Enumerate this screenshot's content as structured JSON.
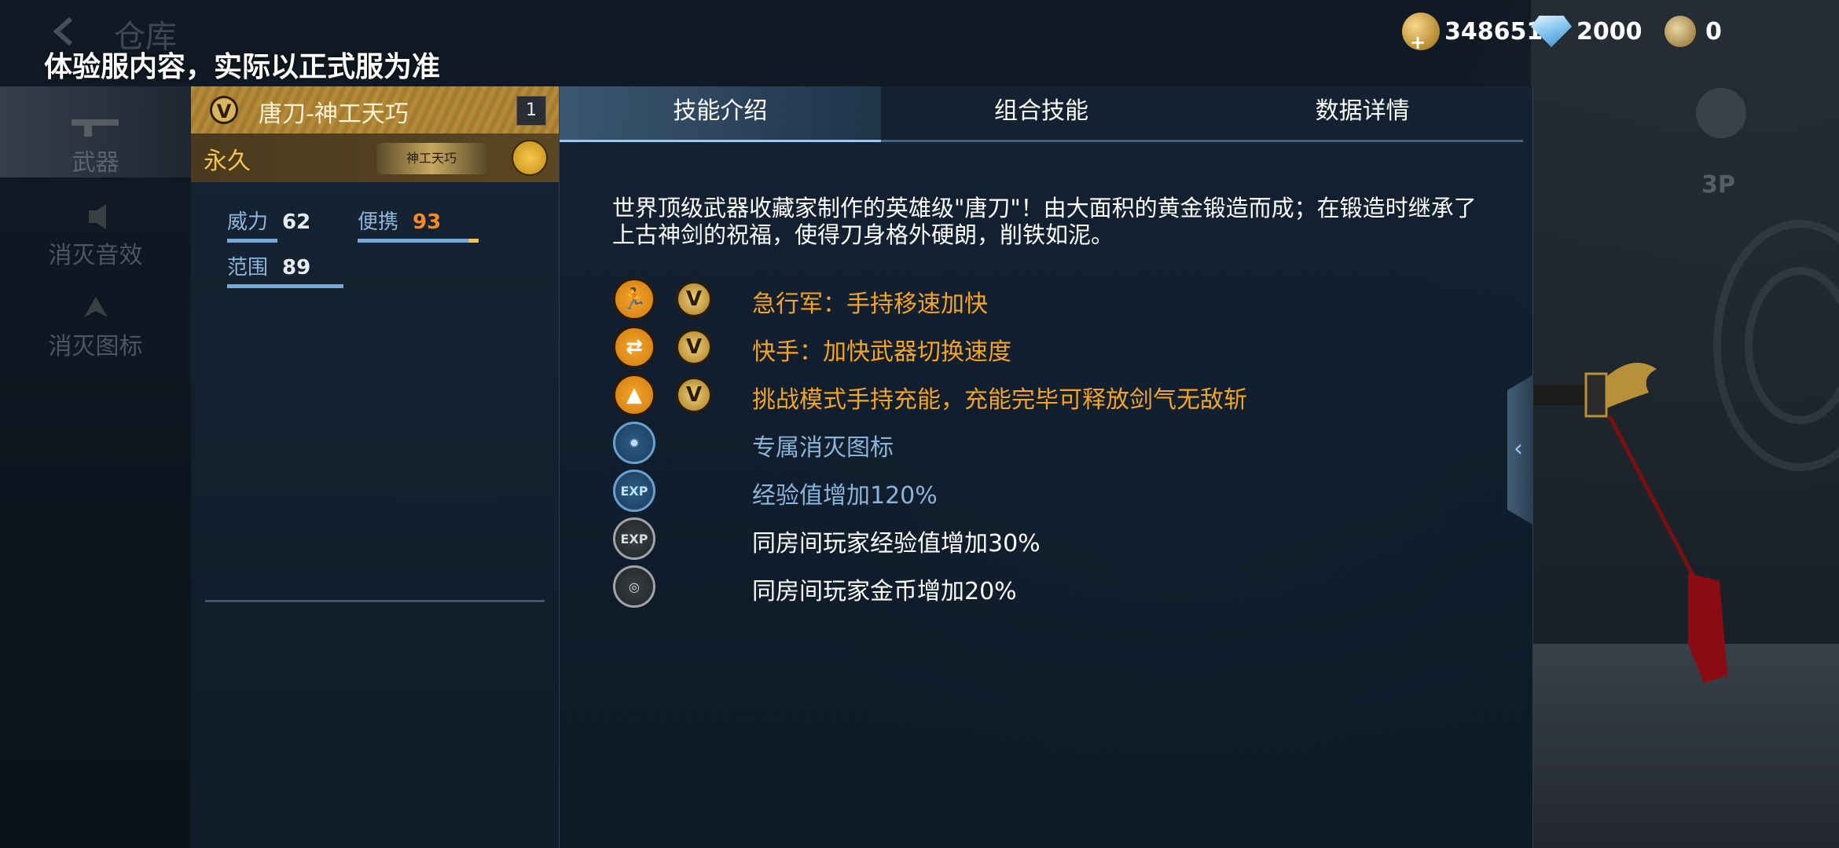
{
  "header": {
    "back_title": "仓库",
    "notice": "体验服内容，实际以正式服为准"
  },
  "currency": {
    "gold": "348651",
    "diamond": "2000",
    "medal": "0"
  },
  "side_nav": {
    "items": [
      {
        "label": "武器",
        "icon": "rifle-icon",
        "active": true
      },
      {
        "label": "消灭音效",
        "icon": "speaker-icon",
        "active": false
      },
      {
        "label": "消灭图标",
        "icon": "wings-emblem-icon",
        "active": false
      }
    ]
  },
  "right_hud": {
    "view_label": "3P"
  },
  "weapon": {
    "rank_badge": "V",
    "name": "唐刀-神工天巧",
    "count": "1",
    "duration": "永久",
    "badge_text": "神工天巧",
    "stats": [
      {
        "label": "威力",
        "value": "62",
        "fraction": 0.62
      },
      {
        "label": "便携",
        "value": "93",
        "fraction": 0.93
      },
      {
        "label": "范围",
        "value": "89",
        "fraction": 0.89
      }
    ]
  },
  "tabs": [
    {
      "label": "技能介绍",
      "active": true
    },
    {
      "label": "组合技能",
      "active": false
    },
    {
      "label": "数据详情",
      "active": false
    }
  ],
  "description": "世界顶级武器收藏家制作的英雄级\"唐刀\"！由大面积的黄金锻造而成；在锻造时继承了上古神剑的祝福，使得刀身格外硬朗，削铁如泥。",
  "skills": [
    {
      "icon": "running-man-icon",
      "style": "gold",
      "vip": "V",
      "text": "急行军：手持移速加快"
    },
    {
      "icon": "weapon-swap-icon",
      "style": "gold",
      "vip": "V",
      "text": "快手：加快武器切换速度"
    },
    {
      "icon": "warning-triangle-icon",
      "style": "gold",
      "vip": "V",
      "text": "挑战模式手持充能，充能完毕可释放剑气无敌斩"
    },
    {
      "icon": "kill-emblem-icon",
      "style": "blue",
      "vip": "",
      "text": "专属消灭图标"
    },
    {
      "icon": "exp-icon",
      "style": "blue",
      "vip": "",
      "text": "经验值增加120%",
      "icon_text": "EXP"
    },
    {
      "icon": "room-exp-icon",
      "style": "grey",
      "vip": "",
      "text": "同房间玩家经验值增加30%",
      "icon_text": "EXP"
    },
    {
      "icon": "room-coin-icon",
      "style": "grey",
      "vip": "",
      "text": "同房间玩家金币增加20%"
    }
  ],
  "colors": {
    "gold_text": "#f2a52a",
    "blue_text": "#8ab4da",
    "accent_tab": "#9cc8f0"
  }
}
